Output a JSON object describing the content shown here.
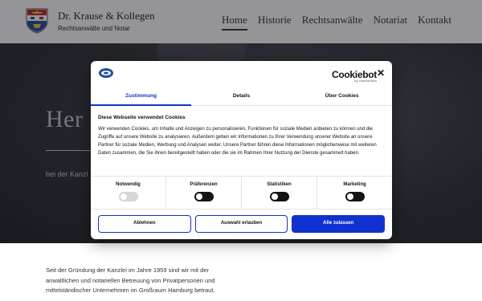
{
  "header": {
    "title": "Dr. Krause & Kollegen",
    "subtitle": "Rechtsanwälte und Notar",
    "nav": [
      "Home",
      "Historie",
      "Rechtsanwälte",
      "Notariat",
      "Kontakt"
    ]
  },
  "hero": {
    "heading_visible": "Her",
    "subtext_visible": "bei der Kanzl"
  },
  "intro": {
    "text": "Seit der Gründung der Kanzlei im Jahre 1959 sind wir mit der anwaltlichen und notariellen Betreuung von Privatpersonen und mittelständischer Unternehmen im Großraum Hamburg betraut."
  },
  "cookie": {
    "brand": "Cookiebot",
    "brand_by": "by Usercentrics",
    "close": "✕",
    "tabs": [
      "Zustimmung",
      "Details",
      "Über Cookies"
    ],
    "active_tab": 0,
    "title": "Diese Webseite verwendet Cookies",
    "text": "Wir verwenden Cookies, um Inhalte und Anzeigen zu personalisieren, Funktionen für soziale Medien anbieten zu können und die Zugriffe auf unsere Website zu analysieren. Außerdem geben wir Informationen zu Ihrer Verwendung unserer Website an unsere Partner für soziale Medien, Werbung und Analysen weiter. Unsere Partner führen diese Informationen möglicherweise mit weiteren Daten zusammen, die Sie ihnen bereitgestellt haben oder die sie im Rahmen Ihrer Nutzung der Dienste gesammelt haben.",
    "switches": [
      {
        "label": "Notwendig",
        "disabled": true
      },
      {
        "label": "Präferenzen",
        "disabled": false
      },
      {
        "label": "Statistiken",
        "disabled": false
      },
      {
        "label": "Marketing",
        "disabled": false
      }
    ],
    "buttons": {
      "decline": "Ablehnen",
      "selection": "Auswahl erlauben",
      "accept_all": "Alle zulassen"
    },
    "accent": "#1032cf"
  }
}
